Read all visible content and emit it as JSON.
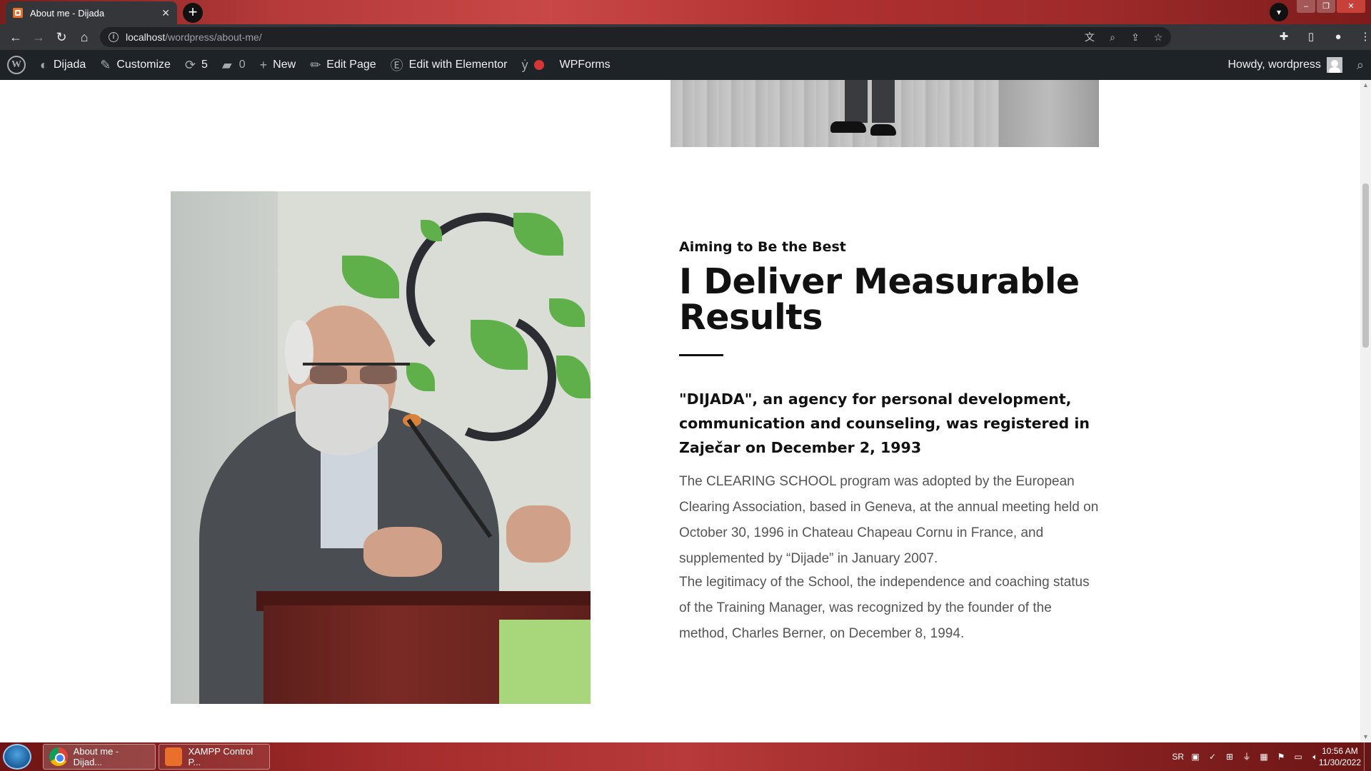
{
  "browser": {
    "tab_title": "About me - Dijada",
    "new_tab_symbol": "+",
    "url_host": "localhost",
    "url_path": "/wordpress/about-me/"
  },
  "adminbar": {
    "site_name": "Dijada",
    "customize": "Customize",
    "updates_count": "5",
    "comments_count": "0",
    "new_label": "New",
    "edit_page": "Edit Page",
    "edit_elementor": "Edit with Elementor",
    "wpforms": "WPForms",
    "howdy": "Howdy, wordpress"
  },
  "content": {
    "eyebrow": "Aiming to Be the Best",
    "headline": "I Deliver Measurable Results",
    "lead": "\"DIJADA\", an agency for personal development, communication and counseling, was registered in Zaječar on December 2, 1993",
    "body1": "The CLEARING SCHOOL program was adopted by the European Clearing Association, based in Geneva, at the annual meeting held on October 30, 1996 in Chateau Chapeau Cornu in France, and supplemented by “Dijade” in January 2007.",
    "body2": "The legitimacy of the School, the independence and coaching status of the Training Manager, was recognized by the founder of the method, Charles Berner, on December 8, 1994."
  },
  "taskbar": {
    "chrome_label": "About me - Dijad...",
    "xampp_label": "XAMPP Control P...",
    "lang": "SR",
    "time": "10:56 AM",
    "date": "11/30/2022"
  },
  "icons": {
    "wordpress": "wordpress-logo-icon",
    "dashboard": "dashboard-icon",
    "brush": "brush-icon",
    "updates": "refresh-icon",
    "comments": "comment-icon",
    "plus": "plus-icon",
    "pencil": "pencil-icon",
    "elementor": "elementor-icon",
    "yoast": "yoast-icon",
    "search": "search-icon"
  },
  "colors": {
    "adminbar_bg": "#1d2327",
    "text_dark": "#111111",
    "text_body": "#555555",
    "accent_red": "#d63638"
  }
}
